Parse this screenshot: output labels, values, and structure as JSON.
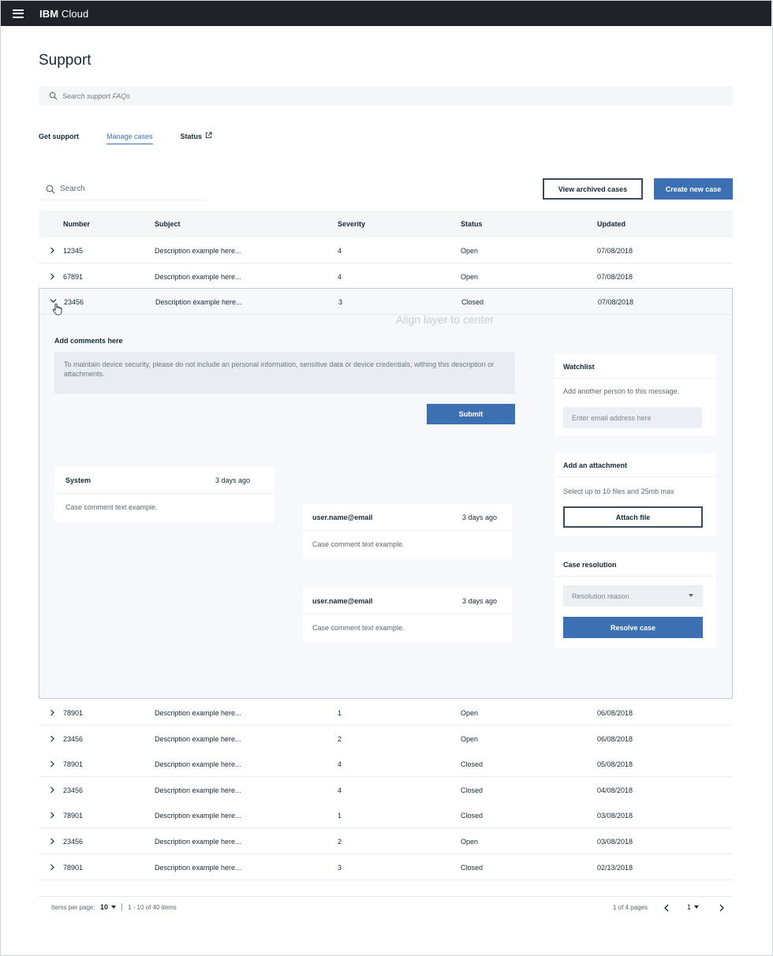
{
  "header": {
    "brand_bold": "IBM",
    "brand_rest": " Cloud"
  },
  "page": {
    "title": "Support"
  },
  "faq_search": {
    "placeholder": "Search support FAQs"
  },
  "tabs": [
    {
      "label": "Get support"
    },
    {
      "label": "Manage cases"
    },
    {
      "label": "Status"
    }
  ],
  "case_search": {
    "placeholder": "Search"
  },
  "buttons": {
    "view_archived": "View archived  cases",
    "create_new": "Create new case"
  },
  "table": {
    "columns": [
      "Number",
      "Subject",
      "Severity",
      "Status",
      "Updated"
    ],
    "rows_top": [
      {
        "number": "12345",
        "subject": "Description example here...",
        "severity": "4",
        "status": "Open",
        "updated": "07/08/2018"
      },
      {
        "number": "67891",
        "subject": "Description example here...",
        "severity": "4",
        "status": "Open",
        "updated": "07/08/2018"
      }
    ],
    "expanded_row": {
      "number": "23456",
      "subject": "Description example here...",
      "severity": "3",
      "status": "Closed",
      "updated": "07/08/2018"
    },
    "rows_bottom": [
      {
        "number": "78901",
        "subject": "Description example here...",
        "severity": "1",
        "status": "Open",
        "updated": "06/08/2018"
      },
      {
        "number": "23456",
        "subject": "Description example here...",
        "severity": "2",
        "status": "Open",
        "updated": "06/08/2018"
      },
      {
        "number": "78901",
        "subject": "Description example here...",
        "severity": "4",
        "status": "Closed",
        "updated": "05/08/2018"
      },
      {
        "number": "23456",
        "subject": "Description example here...",
        "severity": "4",
        "status": "Closed",
        "updated": "04/08/2018"
      },
      {
        "number": "78901",
        "subject": "Description example here...",
        "severity": "1",
        "status": "Closed",
        "updated": "03/08/2018"
      },
      {
        "number": "23456",
        "subject": "Description example here...",
        "severity": "2",
        "status": "Open",
        "updated": "03/08/2018"
      },
      {
        "number": "78901",
        "subject": "Description example here...",
        "severity": "3",
        "status": "Closed",
        "updated": "02/13/2018"
      }
    ]
  },
  "expanded": {
    "align_note": "Align layer to center",
    "comments_label": "Add comments here",
    "comment_placeholder": "To maintain device security, please do not include an personal information, sensitive data or device credentials, withing this description or attachments.",
    "submit": "Submit",
    "comments": [
      {
        "author": "System",
        "time": "3 days ago",
        "text": "Case comment text example."
      },
      {
        "author": "user.name@email",
        "time": "3 days ago",
        "text": "Case comment text example."
      },
      {
        "author": "user.name@email",
        "time": "3 days ago",
        "text": "Case comment text example."
      }
    ],
    "watchlist": {
      "title": "Watchlist",
      "text": "Add another person to this message.",
      "placeholder": "Enter email address here"
    },
    "attachment": {
      "title": "Add an attachment",
      "text": "Select up to 10 files and 25mb max",
      "button": "Attach file"
    },
    "resolution": {
      "title": "Case resolution",
      "select_placeholder": "Resolution reason",
      "button": "Resolve case"
    }
  },
  "pagination": {
    "items_per_page_label": "Items per page:",
    "items_per_page": "10",
    "range": "1 - 10 of 40 items",
    "pages_label": "1 of 4 pages",
    "current_page": "1"
  },
  "colors": {
    "primary": "#3d70b2",
    "topbar": "#1f2228",
    "text": "#152935"
  },
  "icons": [
    "menu-icon",
    "search-icon",
    "launch-icon",
    "chevron-right-icon",
    "chevron-down-icon",
    "caret-down-icon",
    "hand-cursor-icon",
    "chevron-left-icon"
  ]
}
